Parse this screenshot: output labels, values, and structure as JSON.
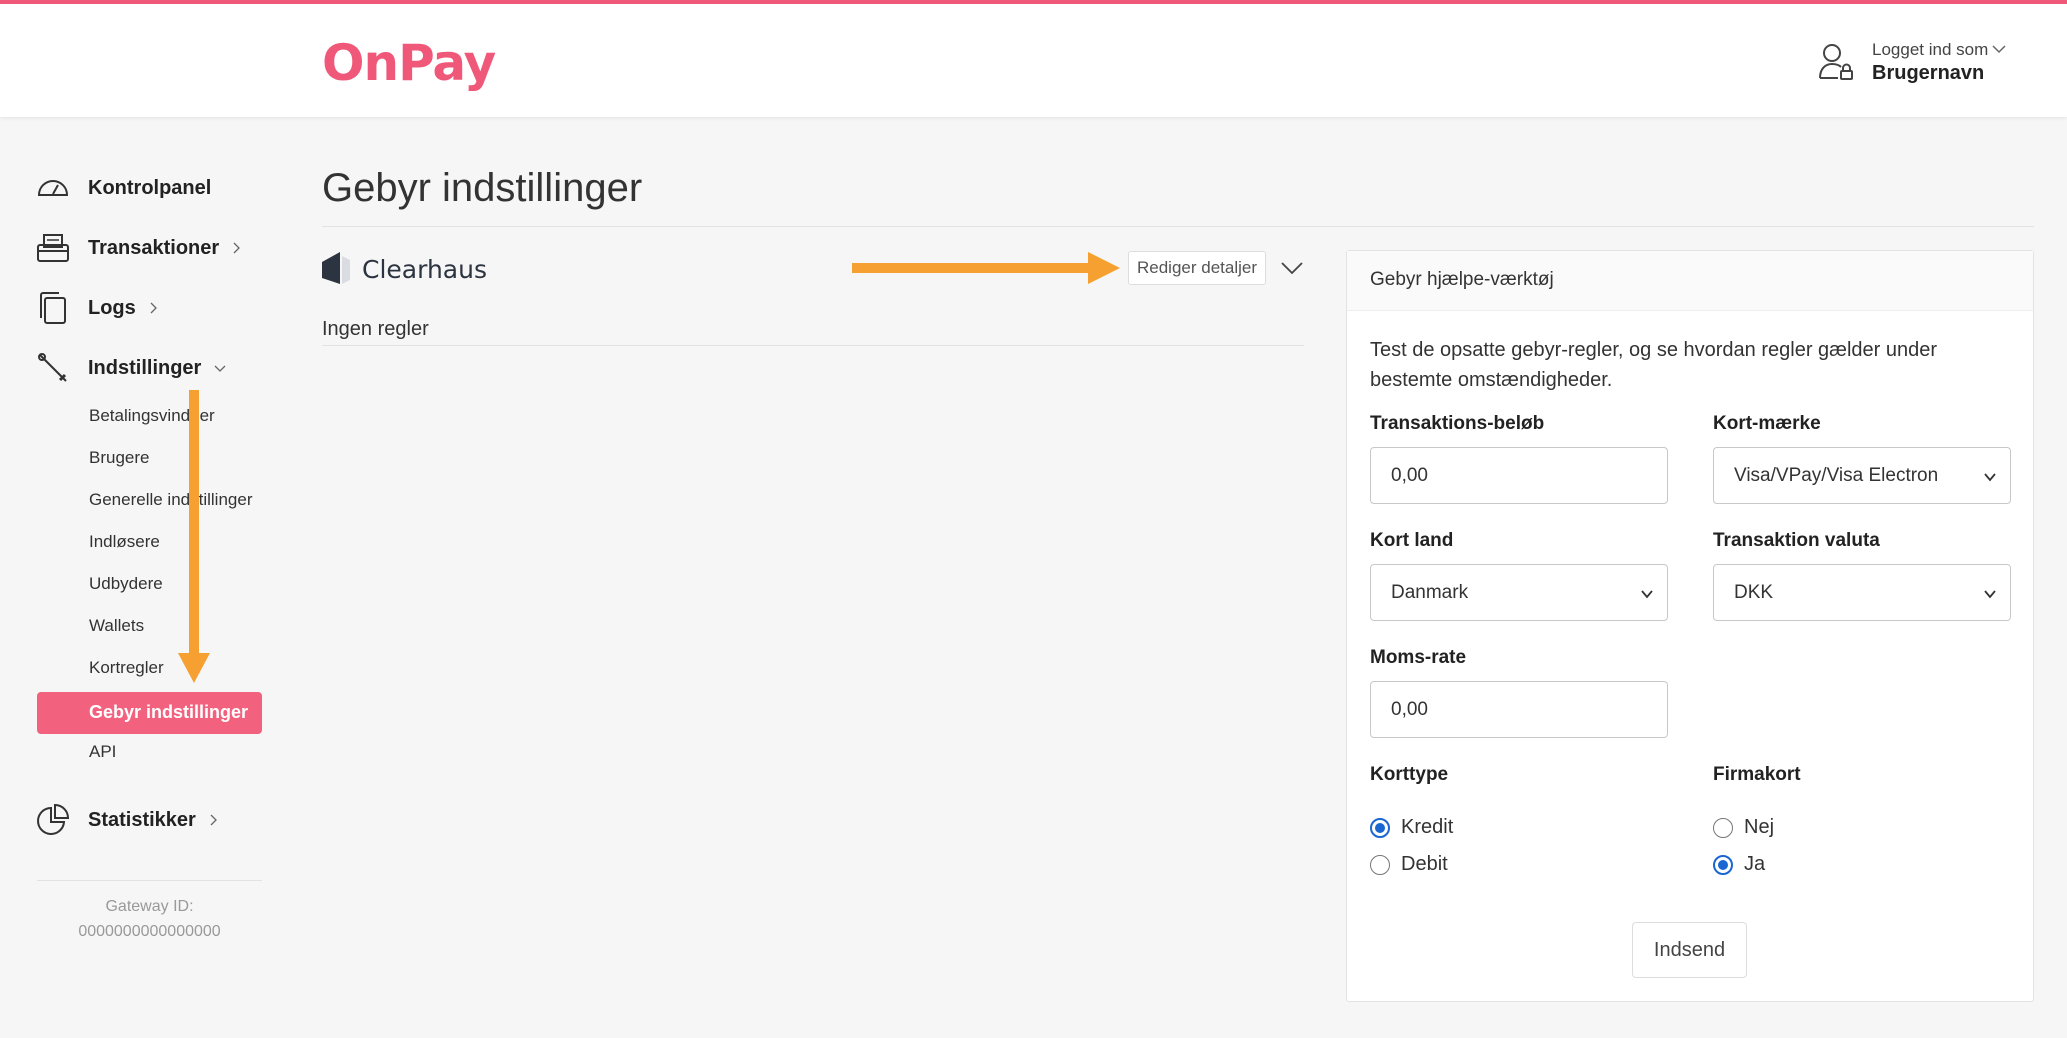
{
  "header": {
    "logo": "OnPay",
    "user_label": "Logget ind som",
    "user_name": "Brugernavn"
  },
  "sidebar": {
    "items": [
      {
        "label": "Kontrolpanel",
        "icon": "dashboard-gauge-icon"
      },
      {
        "label": "Transaktioner",
        "icon": "card-reader-icon"
      },
      {
        "label": "Logs",
        "icon": "documents-icon"
      },
      {
        "label": "Indstillinger",
        "icon": "tools-icon"
      },
      {
        "label": "Statistikker",
        "icon": "pie-chart-icon"
      }
    ],
    "settings_subitems": [
      "Betalingsvinduer",
      "Brugere",
      "Generelle indstillinger",
      "Indløsere",
      "Udbydere",
      "Wallets",
      "Kortregler",
      "Gebyr indstillinger",
      "API"
    ],
    "active_subitem": "Gebyr indstillinger",
    "gateway_label": "Gateway ID:",
    "gateway_id": "0000000000000000"
  },
  "main": {
    "title": "Gebyr indstillinger",
    "provider": "Clearhaus",
    "edit_label": "Rediger detaljer",
    "no_rules": "Ingen regler"
  },
  "tool": {
    "title": "Gebyr hjælpe-værktøj",
    "description": "Test de opsatte gebyr-regler, og se hvordan regler gælder under bestemte omstændigheder.",
    "amount_label": "Transaktions-beløb",
    "amount_value": "0,00",
    "brand_label": "Kort-mærke",
    "brand_value": "Visa/VPay/Visa Electron",
    "country_label": "Kort land",
    "country_value": "Danmark",
    "currency_label": "Transaktion valuta",
    "currency_value": "DKK",
    "vat_label": "Moms-rate",
    "vat_value": "0,00",
    "cardtype_label": "Korttype",
    "cardtype_options": [
      "Kredit",
      "Debit"
    ],
    "cardtype_selected": "Kredit",
    "corporate_label": "Firmakort",
    "corporate_options": [
      "Nej",
      "Ja"
    ],
    "corporate_selected": "Ja",
    "submit_label": "Indsend"
  },
  "colors": {
    "brand": "#f0587a",
    "active_nav": "#f2627e",
    "annotation_arrow": "#f5a030",
    "radio_selected": "#1a66d2"
  }
}
